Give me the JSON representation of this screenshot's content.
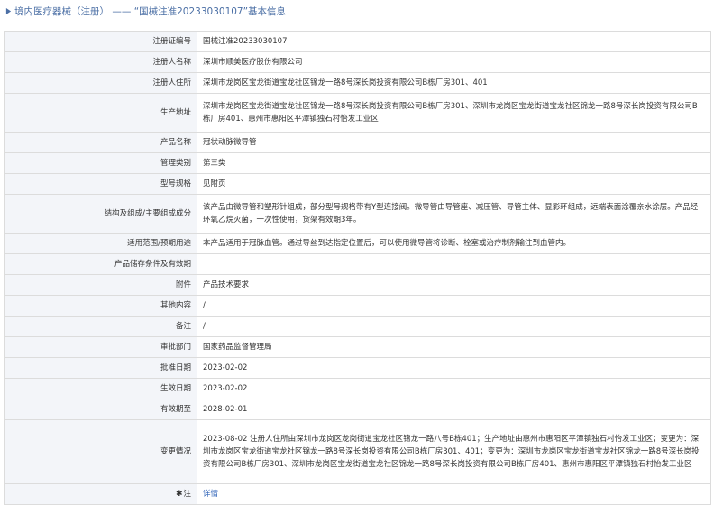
{
  "header": {
    "section": "境内医疗器械（注册）",
    "separator": "——",
    "title": "“国械注准20233030107”基本信息"
  },
  "rows": [
    {
      "label": "注册证编号",
      "value": "国械注准20233030107",
      "h": 23
    },
    {
      "label": "注册人名称",
      "value": "深圳市顺美医疗股份有限公司",
      "h": 23
    },
    {
      "label": "注册人住所",
      "value": "深圳市龙岗区宝龙街道宝龙社区锦龙一路8号深长岗投资有限公司B栋厂房301、401",
      "h": 23
    },
    {
      "label": "生产地址",
      "value": "深圳市龙岗区宝龙街道宝龙社区锦龙一路8号深长岗投资有限公司B栋厂房301、深圳市龙岗区宝龙街道宝龙社区锦龙一路8号深长岗投资有限公司B栋厂房401、惠州市惠阳区平潭镇独石村怡发工业区",
      "h": 43
    },
    {
      "label": "产品名称",
      "value": "冠状动脉微导管",
      "h": 23
    },
    {
      "label": "管理类别",
      "value": "第三类",
      "h": 23
    },
    {
      "label": "型号规格",
      "value": "见附页",
      "h": 23
    },
    {
      "label": "结构及组成/主要组成成分",
      "value": "该产品由微导管和塑形针组成，部分型号规格带有Y型连接阀。微导管由导管座、减压管、导管主体、显影环组成，远端表面涂覆亲水涂层。产品经环氧乙烷灭菌，一次性使用，货架有效期3年。",
      "h": 43
    },
    {
      "label": "适用范围/预期用途",
      "value": "本产品适用于冠脉血管。通过导丝到达指定位置后，可以使用微导管将诊断、栓塞或治疗制剂输注到血管内。",
      "h": 23
    },
    {
      "label": "产品储存条件及有效期",
      "value": "",
      "h": 23
    },
    {
      "label": "附件",
      "value": "产品技术要求",
      "h": 23
    },
    {
      "label": "其他内容",
      "value": "/",
      "h": 23
    },
    {
      "label": "备注",
      "value": "/",
      "h": 23
    },
    {
      "label": "审批部门",
      "value": "国家药品监督管理局",
      "h": 23
    },
    {
      "label": "批准日期",
      "value": "2023-02-02",
      "h": 23
    },
    {
      "label": "生效日期",
      "value": "2023-02-02",
      "h": 23
    },
    {
      "label": "有效期至",
      "value": "2028-02-01",
      "h": 23
    },
    {
      "label": "变更情况",
      "value": "2023-08-02 注册人住所由深圳市龙岗区龙岗街道宝龙社区锦龙一路八号B栋401；生产地址由惠州市惠阳区平潭镇独石村怡发工业区；变更为：深圳市龙岗区宝龙街道宝龙社区锦龙一路8号深长岗投资有限公司B栋厂房301、401；变更为：深圳市龙岗区宝龙街道宝龙社区锦龙一路8号深长岗投资有限公司B栋厂房301、深圳市龙岗区宝龙街道宝龙社区锦龙一路8号深长岗投资有限公司B栋厂房401、惠州市惠阳区平潭镇独石村怡发工业区",
      "h": 71
    },
    {
      "label": "注",
      "value": "详情",
      "h": 23,
      "link": true
    }
  ]
}
